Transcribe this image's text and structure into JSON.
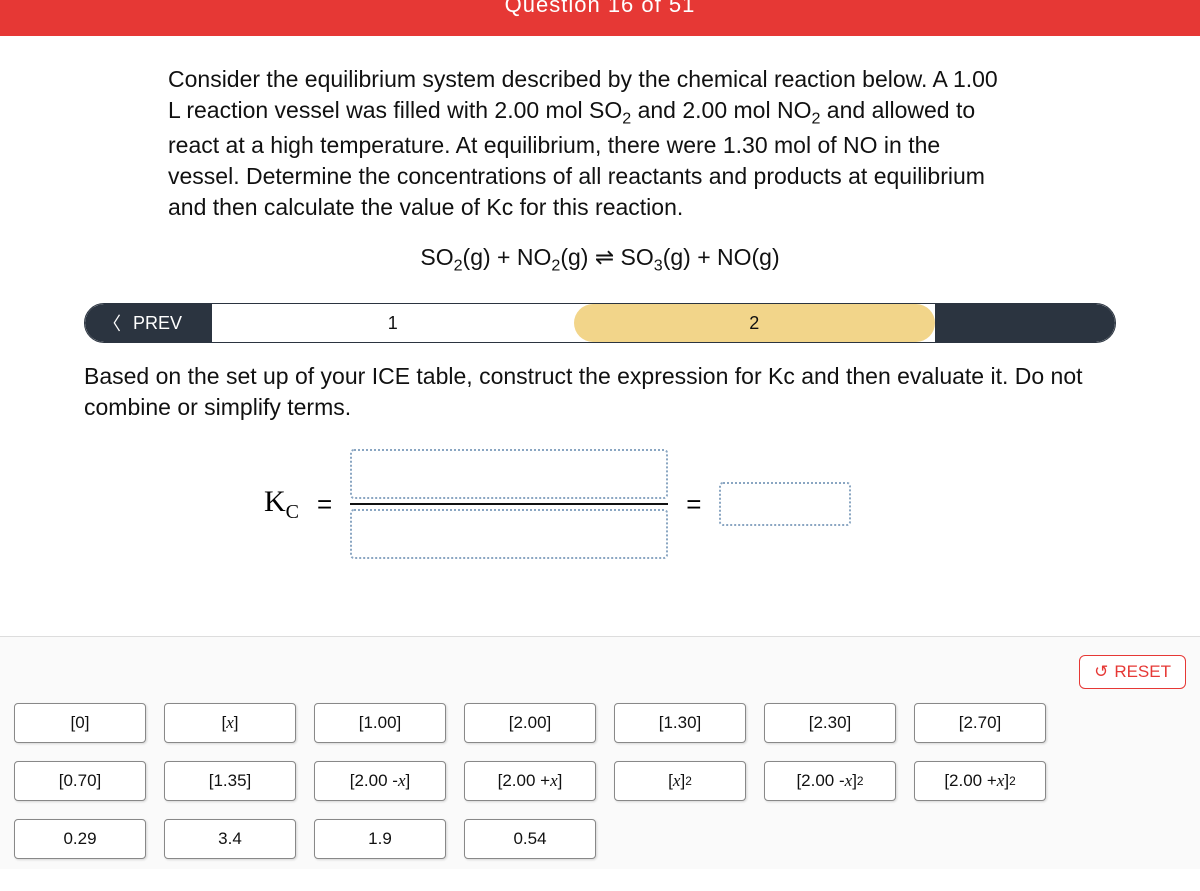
{
  "header": {
    "partial_title": "Question 16 of 51"
  },
  "question": {
    "text_html": "Consider the equilibrium system described by the chemical reaction below. A 1.00 L reaction vessel was filled with 2.00 mol SO<sub>2</sub> and 2.00 mol NO<sub>2</sub> and allowed to react at a high temperature. At equilibrium, there were 1.30 mol of NO in the vessel. Determine the concentrations of all reactants and products at equilibrium and then calculate the value of Kc for this reaction.",
    "equation_html": "SO<sub>2</sub>(g) + NO<sub>2</sub>(g) ⇌ SO<sub>3</sub>(g) + NO(g)"
  },
  "nav": {
    "prev_label": "PREV",
    "step1": "1",
    "step2": "2"
  },
  "sub_prompt": "Based on the set up of your ICE table, construct the expression for Kc and then evaluate it. Do not combine or simplify terms.",
  "kc": {
    "label_html": "K<sub>C</sub>",
    "eq": "="
  },
  "reset_label": "RESET",
  "tiles": [
    {
      "html": "[0]"
    },
    {
      "html": "[<span class='it'>x</span>]"
    },
    {
      "html": "[1.00]"
    },
    {
      "html": "[2.00]"
    },
    {
      "html": "[1.30]"
    },
    {
      "html": "[2.30]"
    },
    {
      "html": "[2.70]"
    },
    {
      "html": "[0.70]"
    },
    {
      "html": "[1.35]"
    },
    {
      "html": "[2.00 - <span class='it'>x</span>]"
    },
    {
      "html": "[2.00 + <span class='it'>x</span>]"
    },
    {
      "html": "[<span class='it'>x</span>]<sup>2</sup>"
    },
    {
      "html": "[2.00 - <span class='it'>x</span>]<sup>2</sup>"
    },
    {
      "html": "[2.00 + <span class='it'>x</span>]<sup>2</sup>"
    },
    {
      "html": "0.29"
    },
    {
      "html": "3.4"
    },
    {
      "html": "1.9"
    },
    {
      "html": "0.54"
    }
  ]
}
